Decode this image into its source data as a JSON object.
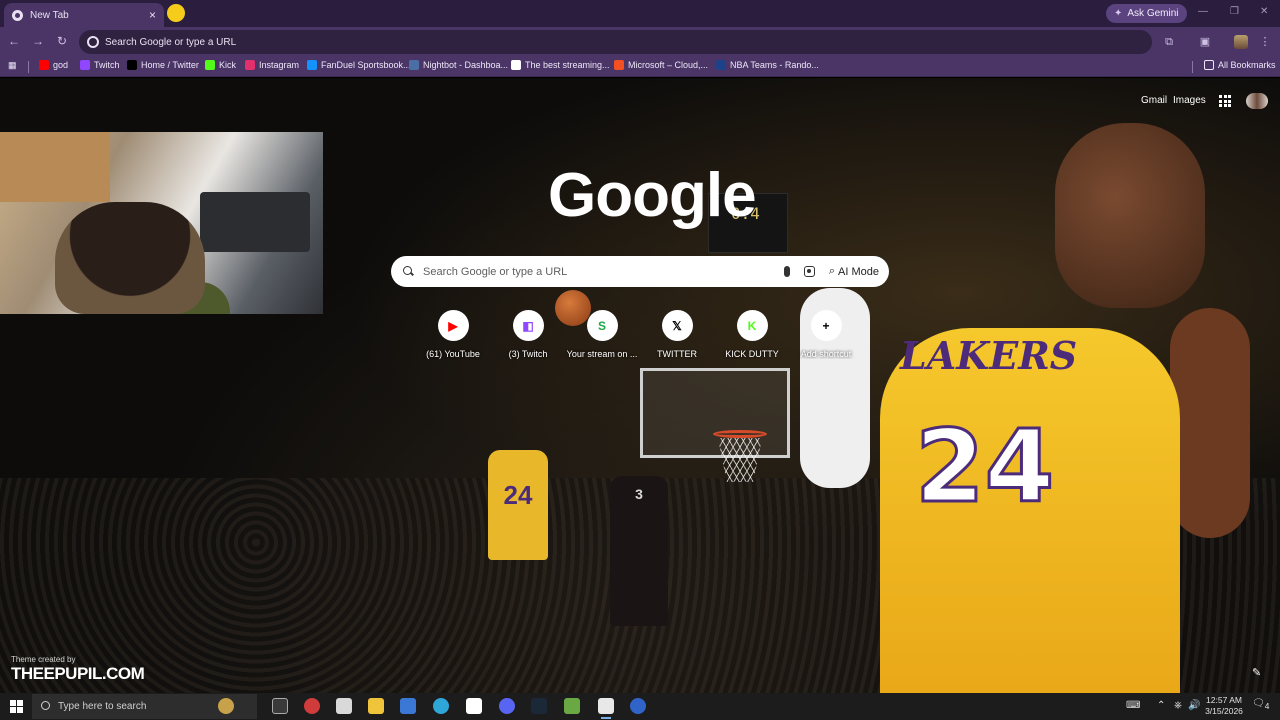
{
  "tab": {
    "title": "New Tab",
    "close": "×"
  },
  "gemini": {
    "label": "Ask Gemini"
  },
  "window": {
    "minimize": "—",
    "restore": "❐",
    "close": "✕"
  },
  "omnibox": {
    "placeholder": "Search Google or type a URL"
  },
  "bookmarks": [
    {
      "label": "god",
      "icon": "youtube-icon",
      "color": "#ff0000"
    },
    {
      "label": "Twitch",
      "icon": "twitch-icon",
      "color": "#9146ff"
    },
    {
      "label": "Home / Twitter",
      "icon": "x-icon",
      "color": "#000000"
    },
    {
      "label": "Kick",
      "icon": "kick-icon",
      "color": "#53fc18"
    },
    {
      "label": "Instagram",
      "icon": "instagram-icon",
      "color": "#e1306c"
    },
    {
      "label": "FanDuel Sportsbook...",
      "icon": "fanduel-icon",
      "color": "#1493ff"
    },
    {
      "label": "Nightbot - Dashboa...",
      "icon": "nightbot-icon",
      "color": "#4a6fa5"
    },
    {
      "label": "The best streaming...",
      "icon": "streaming-icon",
      "color": "#ffffff"
    },
    {
      "label": "Microsoft – Cloud,...",
      "icon": "microsoft-icon",
      "color": "#f25022"
    },
    {
      "label": "NBA Teams - Rando...",
      "icon": "nba-icon",
      "color": "#1d428a"
    }
  ],
  "all_bookmarks": "All Bookmarks",
  "top_links": {
    "gmail": "Gmail",
    "images": "Images"
  },
  "logo": "Google",
  "scoreboard": "0.4",
  "search": {
    "placeholder": "Search Google or type a URL",
    "ai_mode": "AI Mode"
  },
  "shortcuts": [
    {
      "label": "(61) YouTube",
      "icon": "youtube-icon",
      "glyph": "▶",
      "color": "#ff0000"
    },
    {
      "label": "(3) Twitch",
      "icon": "twitch-icon",
      "glyph": "◧",
      "color": "#9146ff"
    },
    {
      "label": "Your stream on ...",
      "icon": "stream-icon",
      "glyph": "S",
      "color": "#20a84a"
    },
    {
      "label": "TWITTER",
      "icon": "x-icon",
      "glyph": "𝕏",
      "color": "#000000"
    },
    {
      "label": "KICK DUTTY",
      "icon": "kick-icon",
      "glyph": "K",
      "color": "#53fc18"
    },
    {
      "label": "Add shortcut",
      "icon": "plus-icon",
      "glyph": "+",
      "color": "#000000"
    }
  ],
  "jersey": {
    "team": "LAKERS",
    "number": "24",
    "jump_number": "24",
    "heat_number": "3"
  },
  "theme_credit": {
    "small": "Theme created by",
    "big": "THEEPUPIL.COM"
  },
  "taskbar": {
    "search_placeholder": "Type here to search",
    "time": "12:57 AM",
    "date": "3/15/2026",
    "notifications": "4"
  }
}
